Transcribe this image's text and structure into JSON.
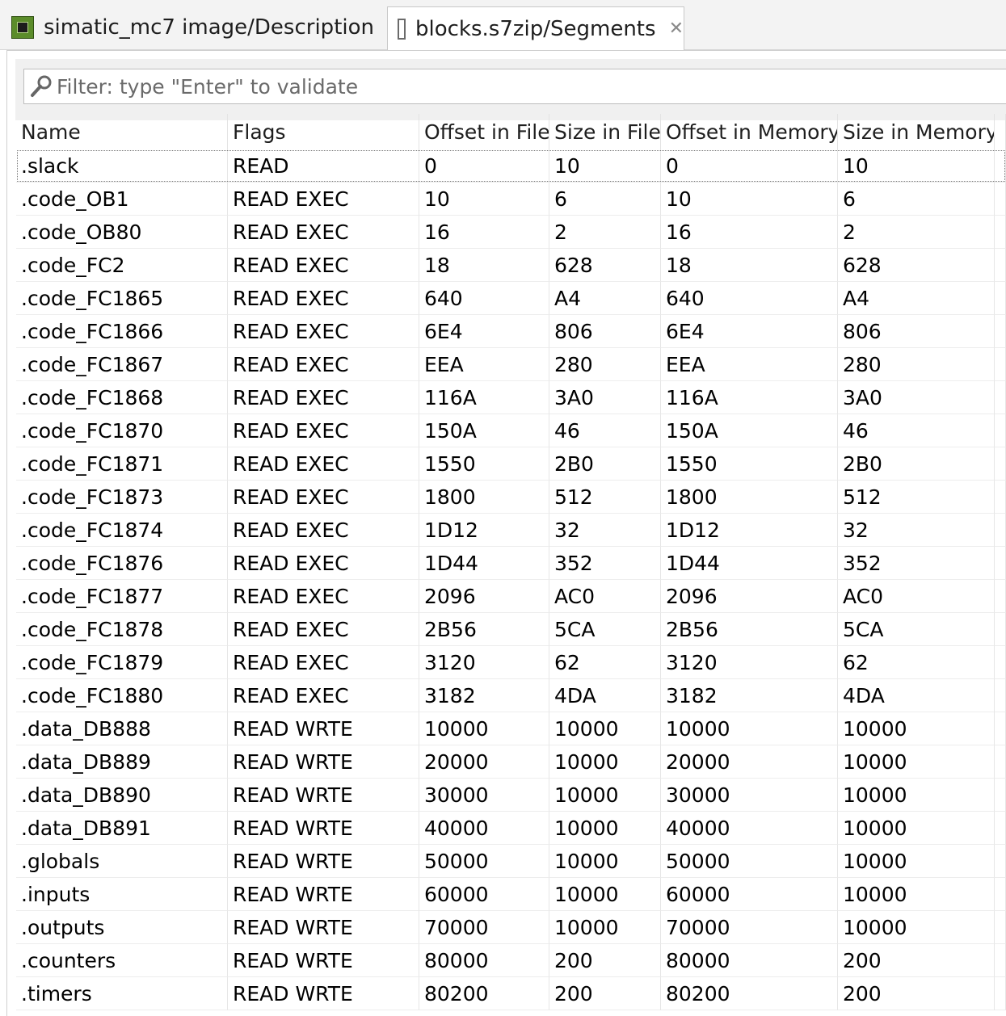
{
  "tabs": [
    {
      "label": "simatic_mc7 image/Description",
      "icon": "chip-icon",
      "active": false
    },
    {
      "label": "blocks.s7zip/Segments",
      "icon": "document-icon",
      "active": true
    }
  ],
  "filter": {
    "placeholder": "Filter: type \"Enter\" to validate",
    "value": ""
  },
  "table": {
    "columns": [
      "Name",
      "Flags",
      "Offset in File",
      "Size in File",
      "Offset in Memory",
      "Size in Memory"
    ],
    "rows": [
      [
        ".slack",
        "READ",
        "0",
        "10",
        "0",
        "10"
      ],
      [
        ".code_OB1",
        "READ EXEC",
        "10",
        "6",
        "10",
        "6"
      ],
      [
        ".code_OB80",
        "READ EXEC",
        "16",
        "2",
        "16",
        "2"
      ],
      [
        ".code_FC2",
        "READ EXEC",
        "18",
        "628",
        "18",
        "628"
      ],
      [
        ".code_FC1865",
        "READ EXEC",
        "640",
        "A4",
        "640",
        "A4"
      ],
      [
        ".code_FC1866",
        "READ EXEC",
        "6E4",
        "806",
        "6E4",
        "806"
      ],
      [
        ".code_FC1867",
        "READ EXEC",
        "EEA",
        "280",
        "EEA",
        "280"
      ],
      [
        ".code_FC1868",
        "READ EXEC",
        "116A",
        "3A0",
        "116A",
        "3A0"
      ],
      [
        ".code_FC1870",
        "READ EXEC",
        "150A",
        "46",
        "150A",
        "46"
      ],
      [
        ".code_FC1871",
        "READ EXEC",
        "1550",
        "2B0",
        "1550",
        "2B0"
      ],
      [
        ".code_FC1873",
        "READ EXEC",
        "1800",
        "512",
        "1800",
        "512"
      ],
      [
        ".code_FC1874",
        "READ EXEC",
        "1D12",
        "32",
        "1D12",
        "32"
      ],
      [
        ".code_FC1876",
        "READ EXEC",
        "1D44",
        "352",
        "1D44",
        "352"
      ],
      [
        ".code_FC1877",
        "READ EXEC",
        "2096",
        "AC0",
        "2096",
        "AC0"
      ],
      [
        ".code_FC1878",
        "READ EXEC",
        "2B56",
        "5CA",
        "2B56",
        "5CA"
      ],
      [
        ".code_FC1879",
        "READ EXEC",
        "3120",
        "62",
        "3120",
        "62"
      ],
      [
        ".code_FC1880",
        "READ EXEC",
        "3182",
        "4DA",
        "3182",
        "4DA"
      ],
      [
        ".data_DB888",
        "READ WRTE",
        "10000",
        "10000",
        "10000",
        "10000"
      ],
      [
        ".data_DB889",
        "READ WRTE",
        "20000",
        "10000",
        "20000",
        "10000"
      ],
      [
        ".data_DB890",
        "READ WRTE",
        "30000",
        "10000",
        "30000",
        "10000"
      ],
      [
        ".data_DB891",
        "READ WRTE",
        "40000",
        "10000",
        "40000",
        "10000"
      ],
      [
        ".globals",
        "READ WRTE",
        "50000",
        "10000",
        "50000",
        "10000"
      ],
      [
        ".inputs",
        "READ WRTE",
        "60000",
        "10000",
        "60000",
        "10000"
      ],
      [
        ".outputs",
        "READ WRTE",
        "70000",
        "10000",
        "70000",
        "10000"
      ],
      [
        ".counters",
        "READ WRTE",
        "80000",
        "200",
        "80000",
        "200"
      ],
      [
        ".timers",
        "READ WRTE",
        "80200",
        "200",
        "80200",
        "200"
      ]
    ]
  }
}
